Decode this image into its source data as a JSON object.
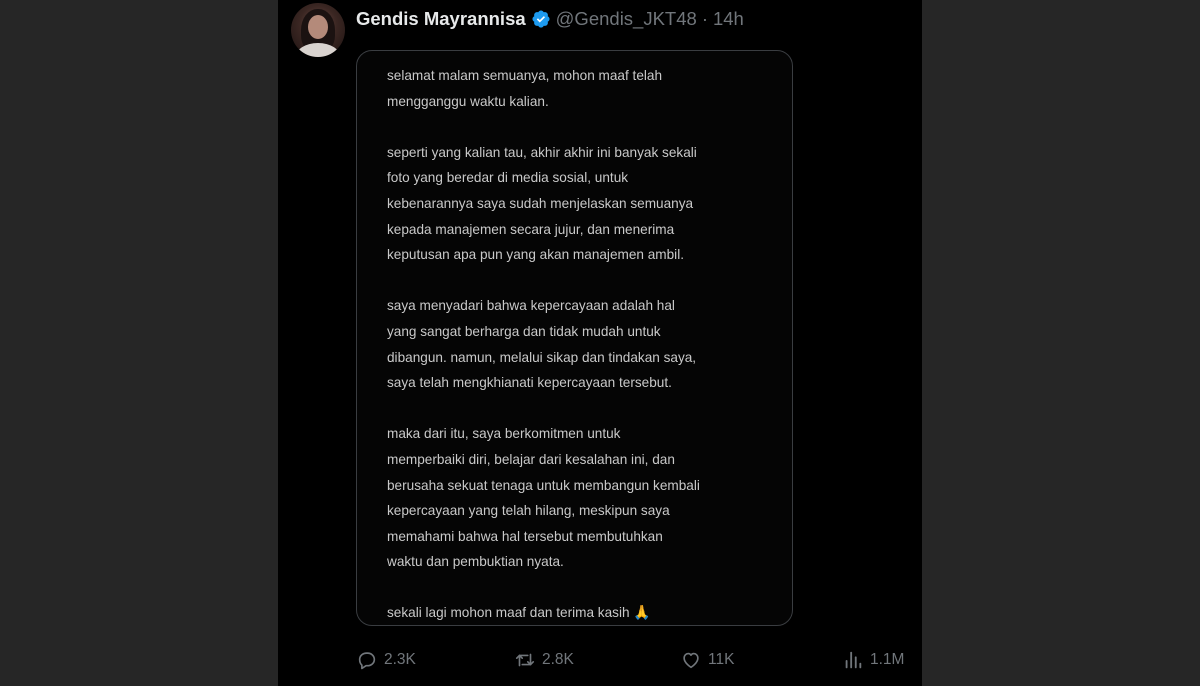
{
  "tweet": {
    "display_name": "Gendis Mayrannisa",
    "handle": "@Gendis_JKT48",
    "separator": "·",
    "time": "14h",
    "verified_color": "#1d9bf0"
  },
  "statement": {
    "paragraphs": [
      [
        "selamat malam semuanya, mohon maaf telah",
        "mengganggu waktu kalian."
      ],
      [
        "seperti yang kalian tau, akhir akhir ini banyak sekali",
        "foto yang beredar di media sosial, untuk",
        "kebenarannya saya sudah menjelaskan semuanya",
        "kepada manajemen secara jujur, dan menerima",
        "keputusan apa pun yang akan manajemen ambil."
      ],
      [
        "saya menyadari bahwa kepercayaan adalah hal",
        "yang sangat berharga dan tidak mudah untuk",
        "dibangun. namun, melalui sikap dan tindakan saya,",
        "saya telah mengkhianati kepercayaan tersebut."
      ],
      [
        "maka dari itu, saya berkomitmen untuk",
        "memperbaiki diri, belajar dari kesalahan ini, dan",
        "berusaha sekuat tenaga untuk membangun kembali",
        "kepercayaan yang telah hilang, meskipun saya",
        "memahami bahwa hal tersebut membutuhkan",
        "waktu dan pembuktian nyata."
      ],
      [
        "sekali lagi mohon maaf dan terima kasih"
      ]
    ],
    "closing_emoji": "🙏"
  },
  "actions": {
    "replies": "2.3K",
    "reposts": "2.8K",
    "likes": "11K",
    "views": "1.1M"
  },
  "icons": {
    "reply": "reply-icon",
    "repost": "repost-icon",
    "like": "heart-icon",
    "views": "views-icon",
    "verified": "verified-badge-icon"
  }
}
